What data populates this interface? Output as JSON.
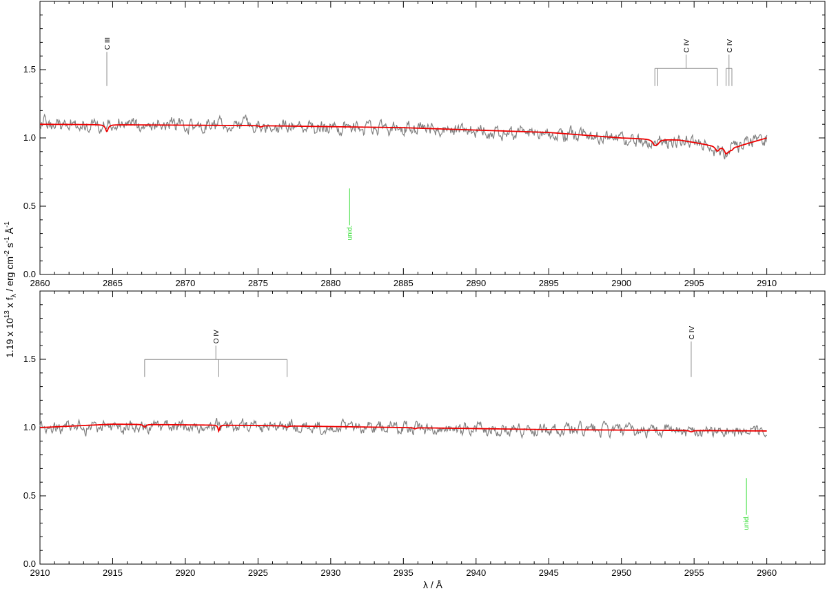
{
  "chart_data": {
    "type": "line",
    "ylabel_parts": {
      "pre": "1.19 x 10",
      "exp1": "13",
      "mid1": "  x f",
      "sub": "λ",
      "mid2": " / erg cm",
      "exp2": "-2",
      "mid3": " s",
      "exp3": "-1",
      "mid4": " Å",
      "exp4": "-1"
    },
    "xlabel": "λ / Å",
    "colors": {
      "observed": "#808080",
      "model": "#ee0000",
      "unid": "#33dd33",
      "marker": "#8c8c8c",
      "frame": "#000000"
    },
    "grid": false,
    "panels": [
      {
        "xlim": [
          2860,
          2914
        ],
        "ylim": [
          0,
          2
        ],
        "xticks": [
          2860,
          2865,
          2870,
          2875,
          2880,
          2885,
          2890,
          2895,
          2900,
          2905,
          2910
        ],
        "yticks": [
          0.0,
          0.5,
          1.0,
          1.5
        ],
        "ytick_labels": [
          "0.0",
          "0.5",
          "1.0",
          "1.5"
        ],
        "series": [
          {
            "type": "observed",
            "x_range": [
              2860,
              2910
            ],
            "base": [
              [
                2860,
                1.1
              ],
              [
                2875,
                1.09
              ],
              [
                2885,
                1.07
              ],
              [
                2895,
                1.03
              ],
              [
                2900,
                1.0
              ],
              [
                2902.3,
                0.96
              ],
              [
                2904.5,
                0.98
              ],
              [
                2906.5,
                0.92
              ],
              [
                2907.2,
                0.9
              ],
              [
                2910,
                1.01
              ]
            ],
            "noise": 0.045
          },
          {
            "type": "model",
            "x_range": [
              2860,
              2910
            ],
            "continuum": [
              [
                2860,
                1.1
              ],
              [
                2875,
                1.09
              ],
              [
                2885,
                1.075
              ],
              [
                2895,
                1.04
              ],
              [
                2900,
                1.0
              ],
              [
                2904,
                0.985
              ],
              [
                2906,
                0.95
              ],
              [
                2908,
                0.94
              ],
              [
                2910,
                1.0
              ]
            ],
            "absorptions": [
              [
                2864.6,
                0.05,
                0.22
              ],
              [
                2875.2,
                0.01,
                0.2
              ],
              [
                2902.3,
                0.04,
                0.35
              ],
              [
                2902.5,
                0.02,
                0.3
              ],
              [
                2906.6,
                0.04,
                0.35
              ],
              [
                2907.2,
                0.05,
                0.3
              ],
              [
                2907.4,
                0.02,
                0.25
              ],
              [
                2907.6,
                0.02,
                0.25
              ]
            ]
          }
        ],
        "line_ids": [
          {
            "label": "C III",
            "lines": [
              2864.6
            ],
            "y_bottom": 1.38,
            "y_top": 1.63
          },
          {
            "label": "C IV",
            "lines": [
              2902.3,
              2902.5,
              2906.6
            ],
            "y_bottom": 1.38,
            "y_top": 1.61
          },
          {
            "label": "C IV",
            "lines": [
              2907.2,
              2907.4,
              2907.6
            ],
            "y_bottom": 1.38,
            "y_top": 1.61
          }
        ],
        "unid": [
          {
            "label": "unid.",
            "x": 2881.3,
            "y_bottom": 0.25,
            "y_top": 0.63
          }
        ]
      },
      {
        "xlim": [
          2910,
          2964
        ],
        "ylim": [
          0,
          2
        ],
        "xticks": [
          2910,
          2915,
          2920,
          2925,
          2930,
          2935,
          2940,
          2945,
          2950,
          2955,
          2960
        ],
        "yticks": [
          0.0,
          0.5,
          1.0,
          1.5
        ],
        "ytick_labels": [
          "0.0",
          "0.5",
          "1.0",
          "1.5"
        ],
        "series": [
          {
            "type": "observed",
            "x_range": [
              2910,
              2960
            ],
            "base": [
              [
                2910,
                1.0
              ],
              [
                2925,
                1.01
              ],
              [
                2940,
                0.99
              ],
              [
                2960,
                0.97
              ]
            ],
            "noise": 0.04
          },
          {
            "type": "model",
            "x_range": [
              2910,
              2960
            ],
            "continuum": [
              [
                2910,
                1.0
              ],
              [
                2915,
                1.025
              ],
              [
                2925,
                1.015
              ],
              [
                2935,
                1.0
              ],
              [
                2945,
                0.985
              ],
              [
                2960,
                0.975
              ]
            ],
            "absorptions": [
              [
                2917.2,
                0.02,
                0.2
              ],
              [
                2922.3,
                0.045,
                0.12
              ],
              [
                2927.0,
                0.01,
                0.2
              ],
              [
                2935.8,
                0.008,
                0.2
              ],
              [
                2954.8,
                0.01,
                0.25
              ]
            ]
          }
        ],
        "line_ids": [
          {
            "label": "O IV",
            "lines": [
              2917.2,
              2922.3,
              2927.0
            ],
            "y_bottom": 1.37,
            "y_top": 1.6
          },
          {
            "label": "C IV",
            "lines": [
              2954.8
            ],
            "y_bottom": 1.37,
            "y_top": 1.63
          }
        ],
        "unid": [
          {
            "label": "unid.",
            "x": 2958.6,
            "y_bottom": 0.25,
            "y_top": 0.63
          }
        ]
      }
    ]
  }
}
